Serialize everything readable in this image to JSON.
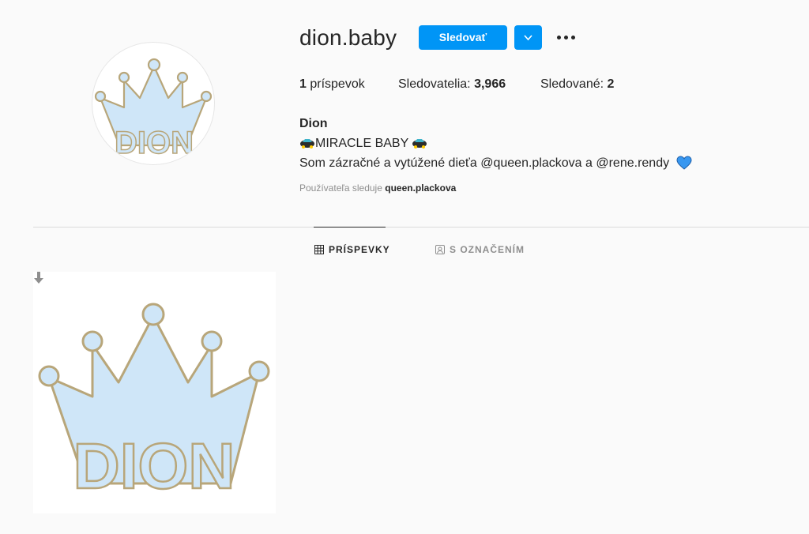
{
  "profile": {
    "username": "dion.baby",
    "follow_label": "Sledovať",
    "stats": {
      "posts_count": "1",
      "posts_label": "príspevok",
      "followers_label": "Sledovatelia:",
      "followers_count": "3,966",
      "following_label": "Sledované:",
      "following_count": "2"
    },
    "bio": {
      "name": "Dion",
      "line1": "MIRACLE BABY",
      "line2": "Som zázračné a vytúžené dieťa @queen.plackova a @rene.rendy"
    },
    "followed_by_label": "Používateľa sleduje",
    "followed_by_account": "queen.plackova"
  },
  "avatar_logo_text": "DION",
  "tabs": [
    {
      "label": "PRÍSPEVKY",
      "icon": "grid-icon",
      "active": true
    },
    {
      "label": "S OZNAČENÍM",
      "icon": "tagged-icon",
      "active": false
    }
  ],
  "posts": [
    {
      "logo_text": "DION",
      "icon": "pinned-icon"
    }
  ],
  "colors": {
    "accent": "#0095f6",
    "crown_fill": "#cfe6f8",
    "crown_stroke": "#b8a67a",
    "heart": "#3897f0"
  }
}
